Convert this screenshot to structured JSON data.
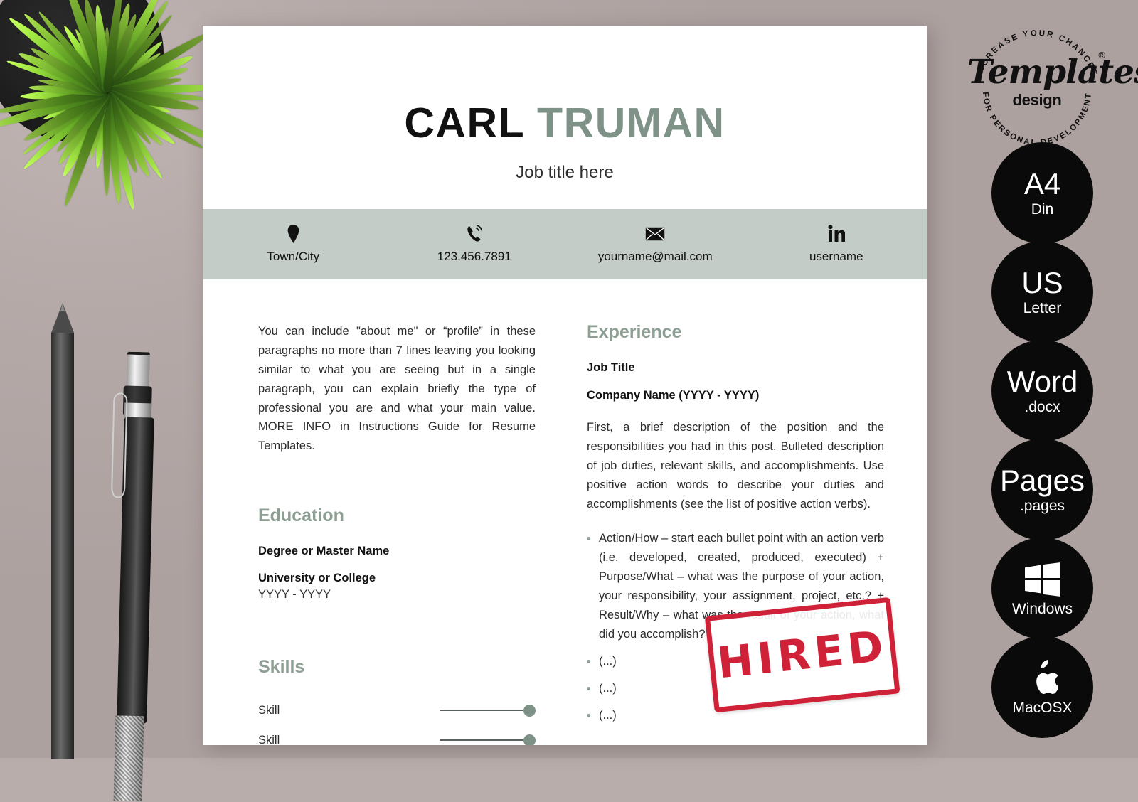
{
  "colors": {
    "background": "#b9adac",
    "accent_green": "#7e9288",
    "heading_green": "#8d9e93",
    "contact_bar": "#c3ccc6",
    "stamp_red": "#cf2137",
    "badge_black": "#0a0a0a"
  },
  "resume": {
    "name_first": "CARL",
    "name_last": "TRUMAN",
    "job_title": "Job title here",
    "contacts": [
      {
        "icon": "location-pin-icon",
        "text": "Town/City"
      },
      {
        "icon": "phone-icon",
        "text": "123.456.7891"
      },
      {
        "icon": "envelope-icon",
        "text": "yourname@mail.com"
      },
      {
        "icon": "linkedin-icon",
        "text": "username"
      }
    ],
    "profile": {
      "text": "You can include \"about me\" or “profile” in these paragraphs no more than 7 lines leaving you looking similar to what you are seeing but in a single paragraph, you can explain briefly the type of professional you are and what your main value. MORE INFO in Instructions Guide for Resume Templates."
    },
    "education": {
      "heading": "Education",
      "degree": "Degree or Master Name",
      "school": "University or College",
      "years": "YYYY - YYYY"
    },
    "skills": {
      "heading": "Skills",
      "items": [
        {
          "label": "Skill",
          "level": 100
        },
        {
          "label": "Skill",
          "level": 100
        }
      ]
    },
    "experience": {
      "heading": "Experience",
      "job_title": "Job Title",
      "company": "Company Name (YYYY - YYYY)",
      "description": "First, a brief description of the position and the responsibilities you had in this post. Bulleted description of job duties, relevant skills, and accomplishments. Use positive action words to describe your duties and accomplishments (see the list of positive action verbs).",
      "bullets": [
        "Action/How – start each bullet point with an action verb (i.e. developed, created, produced, executed) + Purpose/What – what was the purpose of your action, your responsibility, your assignment, project, etc.? + Result/Why – what was the result of your action, what did you accomplish?",
        "(...)",
        "(...)",
        "(...)"
      ]
    }
  },
  "stamp": {
    "text": "HIRED"
  },
  "brand": {
    "arc_top": "INCREASE YOUR CHANCES",
    "arc_bottom": "FOR PERSONAL DEVELOPMENT",
    "word": "Templates",
    "sub": "design",
    "registered": "®"
  },
  "badges": [
    {
      "name": "a4-din-badge",
      "big": "A4",
      "small": "Din",
      "glyph": ""
    },
    {
      "name": "us-letter-badge",
      "big": "US",
      "small": "Letter",
      "glyph": ""
    },
    {
      "name": "word-docx-badge",
      "big": "Word",
      "small": ".docx",
      "glyph": ""
    },
    {
      "name": "pages-badge",
      "big": "Pages",
      "small": ".pages",
      "glyph": ""
    },
    {
      "name": "windows-badge",
      "big": "",
      "small": "Windows",
      "glyph": "windows-logo-icon"
    },
    {
      "name": "macosx-badge",
      "big": "",
      "small": "MacOSX",
      "glyph": "apple-logo-icon"
    }
  ]
}
